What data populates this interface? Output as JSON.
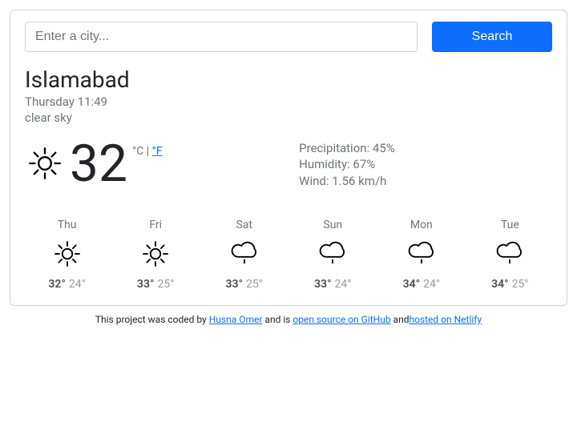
{
  "search": {
    "placeholder": "Enter a city...",
    "button": "Search"
  },
  "weather": {
    "city": "Islamabad",
    "datetime": "Thursday 11:49",
    "description": "clear sky",
    "temp": "32",
    "unit_c": "°C",
    "unit_sep": " | ",
    "unit_f": " °F",
    "precipitation_label": "Precipitation: ",
    "precipitation": "45%",
    "humidity_label": "Humidity: ",
    "humidity": "67%",
    "wind_label": "Wind: ",
    "wind": "1.56 km/h",
    "icon": "sun"
  },
  "forecast": [
    {
      "day": "Thu",
      "icon": "sun",
      "hi": "32°",
      "lo": "24°"
    },
    {
      "day": "Fri",
      "icon": "sun",
      "hi": "33°",
      "lo": "25°"
    },
    {
      "day": "Sat",
      "icon": "rain",
      "hi": "33°",
      "lo": "25°"
    },
    {
      "day": "Sun",
      "icon": "rain",
      "hi": "33°",
      "lo": "24°"
    },
    {
      "day": "Mon",
      "icon": "rain",
      "hi": "34°",
      "lo": "24°"
    },
    {
      "day": "Tue",
      "icon": "rain",
      "hi": "34°",
      "lo": "25°"
    }
  ],
  "footer": {
    "t1": "This project was coded by ",
    "author": "Husna Omer",
    "t2": " and is ",
    "os": "open source on GitHub",
    "t3": " and",
    "host": "hosted on Netlify"
  }
}
